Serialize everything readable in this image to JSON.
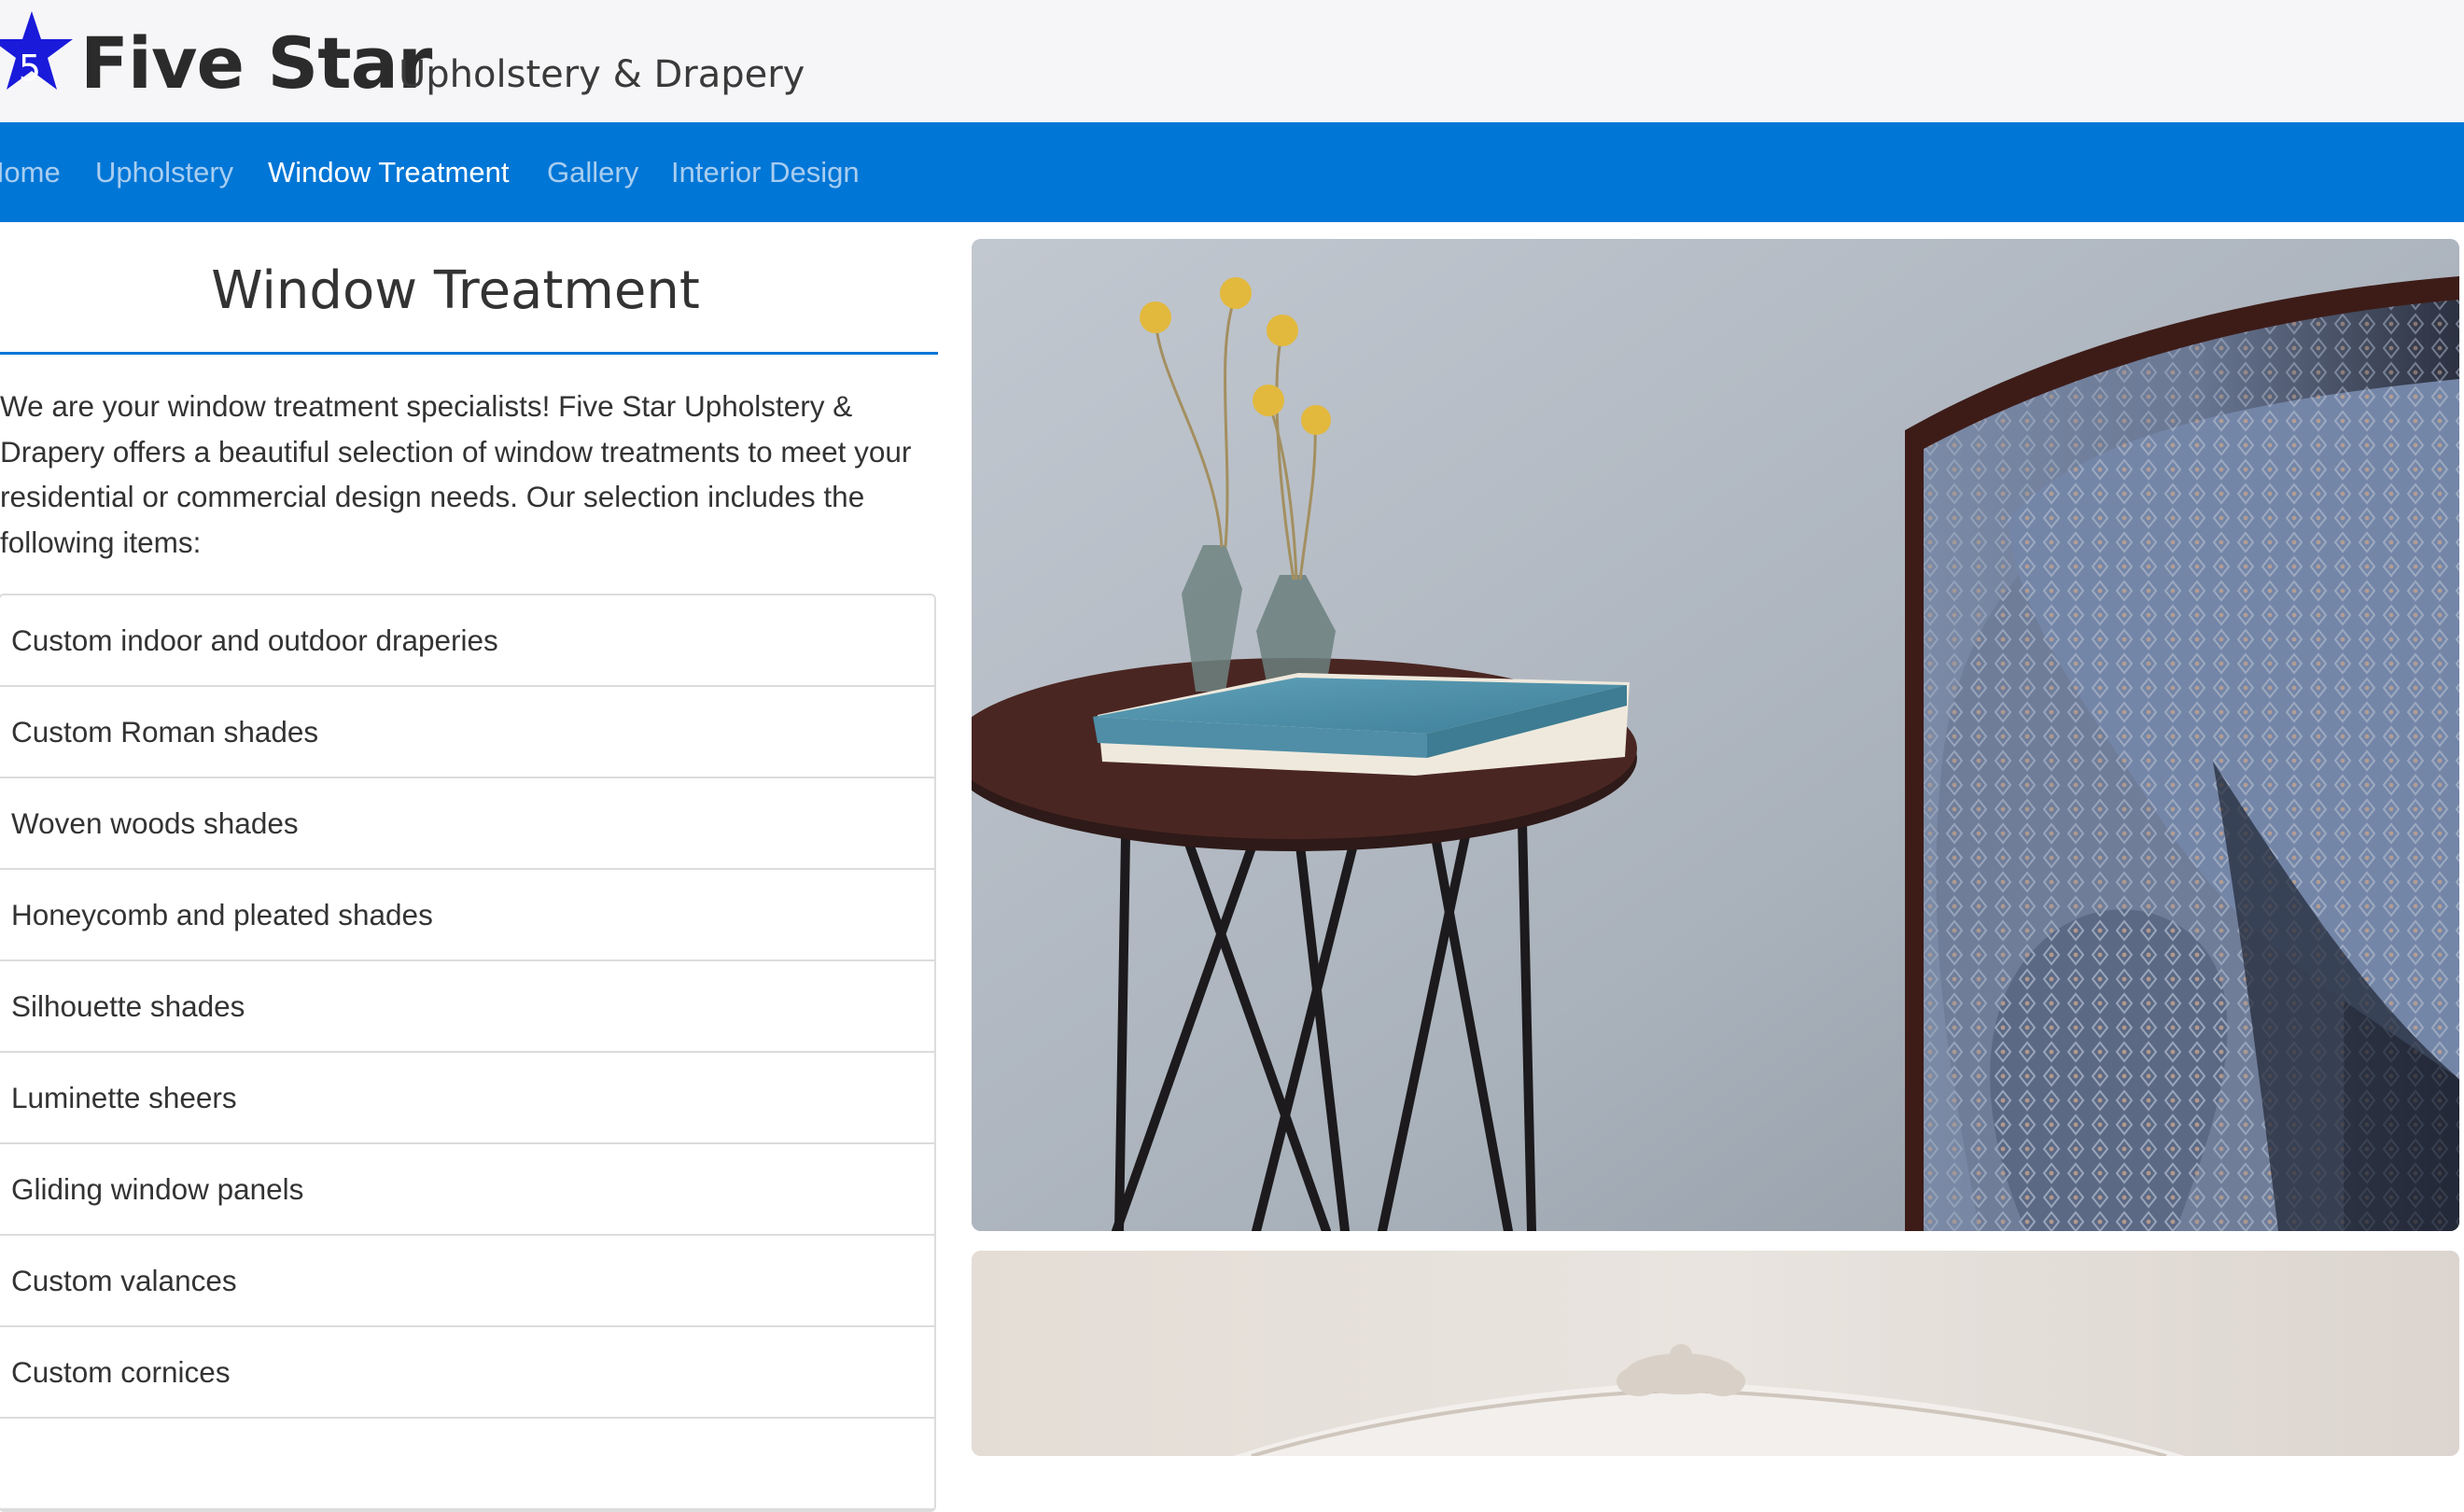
{
  "header": {
    "logo_number": "5",
    "brand_name": "Five Star",
    "brand_subtitle": "Upholstery & Drapery"
  },
  "nav": {
    "items": [
      {
        "label": "Home"
      },
      {
        "label": "Upholstery"
      },
      {
        "label": "Window Treatment",
        "active": true
      },
      {
        "label": "Gallery"
      },
      {
        "label": "Interior Design"
      }
    ]
  },
  "main": {
    "title": "Window Treatment",
    "intro": "We are your window treatment specialists! Five Star Upholstery & Drapery offers a beautiful selection of window treatments to meet your residential or commercial design needs. Our selection includes the following items:",
    "items": [
      {
        "label": "Custom indoor and outdoor draperies"
      },
      {
        "label": "Custom Roman shades"
      },
      {
        "label": "Woven woods shades"
      },
      {
        "label": "Honeycomb and pleated shades"
      },
      {
        "label": "Silhouette shades"
      },
      {
        "label": "Luminette sheers"
      },
      {
        "label": "Gliding window panels"
      },
      {
        "label": "Custom valances"
      },
      {
        "label": "Custom cornices"
      },
      {
        "label": ""
      }
    ]
  },
  "colors": {
    "nav_bar": "#0076d6",
    "logo_star": "#1a1adb",
    "title_rule": "#0076d6"
  },
  "images": [
    {
      "name": "side-table-and-sofa-photo"
    },
    {
      "name": "ornate-headboard-photo"
    }
  ]
}
